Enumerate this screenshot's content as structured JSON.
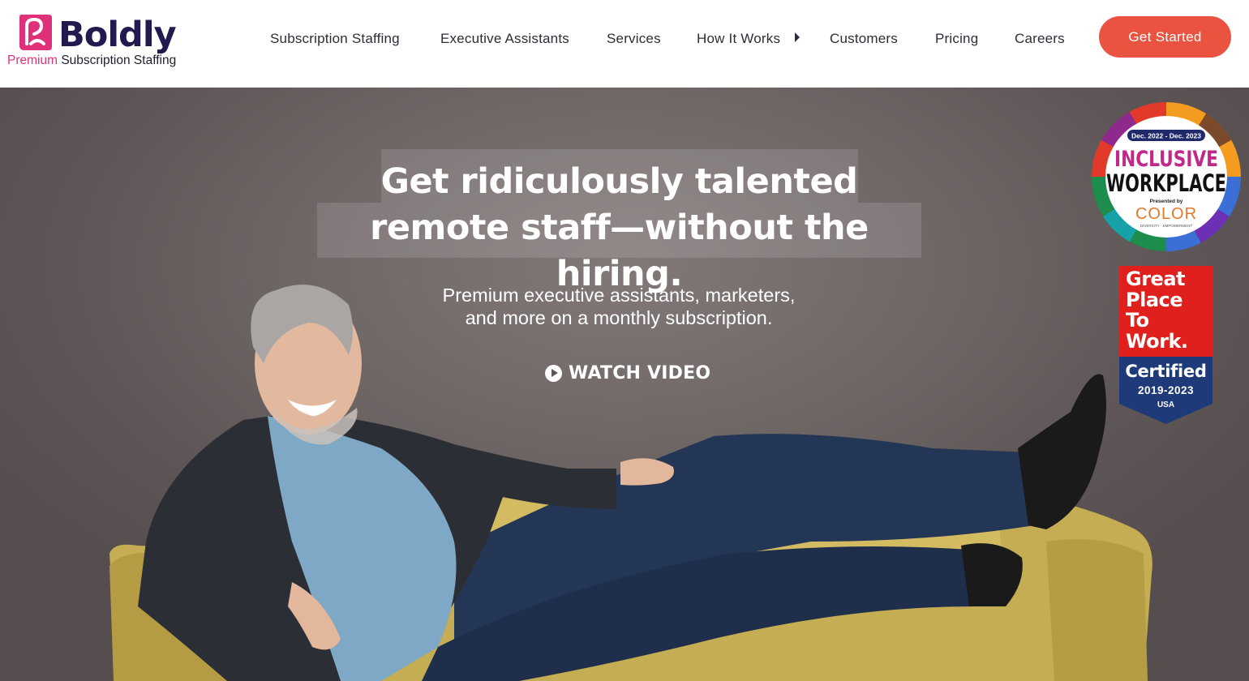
{
  "brand": {
    "name": "Boldly",
    "tagline_accent": "Premium",
    "tagline_rest": " Subscription Staffing",
    "accent_color": "#e0307a",
    "primary_dark": "#211a4f",
    "cta_color": "#e9533f"
  },
  "nav": {
    "items": [
      {
        "label": "Subscription Staffing"
      },
      {
        "label": "Executive Assistants"
      },
      {
        "label": "Services"
      },
      {
        "label": "How It Works",
        "has_submenu": true
      },
      {
        "label": "Customers"
      },
      {
        "label": "Pricing"
      },
      {
        "label": "Careers"
      }
    ],
    "cta_label": "Get Started"
  },
  "hero": {
    "headline_line1": "Get ridiculously talented",
    "headline_line2": "remote staff—without the hiring.",
    "subhead_line1": "Premium executive assistants, marketers,",
    "subhead_line2": "and more on a monthly subscription.",
    "watch_label": "WATCH VIDEO",
    "watch_icon": "play-circle-icon"
  },
  "badges": {
    "inclusive": {
      "dates": "Dec. 2022 - Dec. 2023",
      "line1": "INCLUSIVE",
      "line2": "WORKPLACE",
      "presented": "Presented by",
      "org": "COLOR",
      "org_sub": "DIVERSITY · EMPOWERMENT"
    },
    "gptw": {
      "title_lines": [
        "Great",
        "Place",
        "To",
        "Work."
      ],
      "certified": "Certified",
      "years": "2019-2023",
      "country": "USA"
    }
  }
}
